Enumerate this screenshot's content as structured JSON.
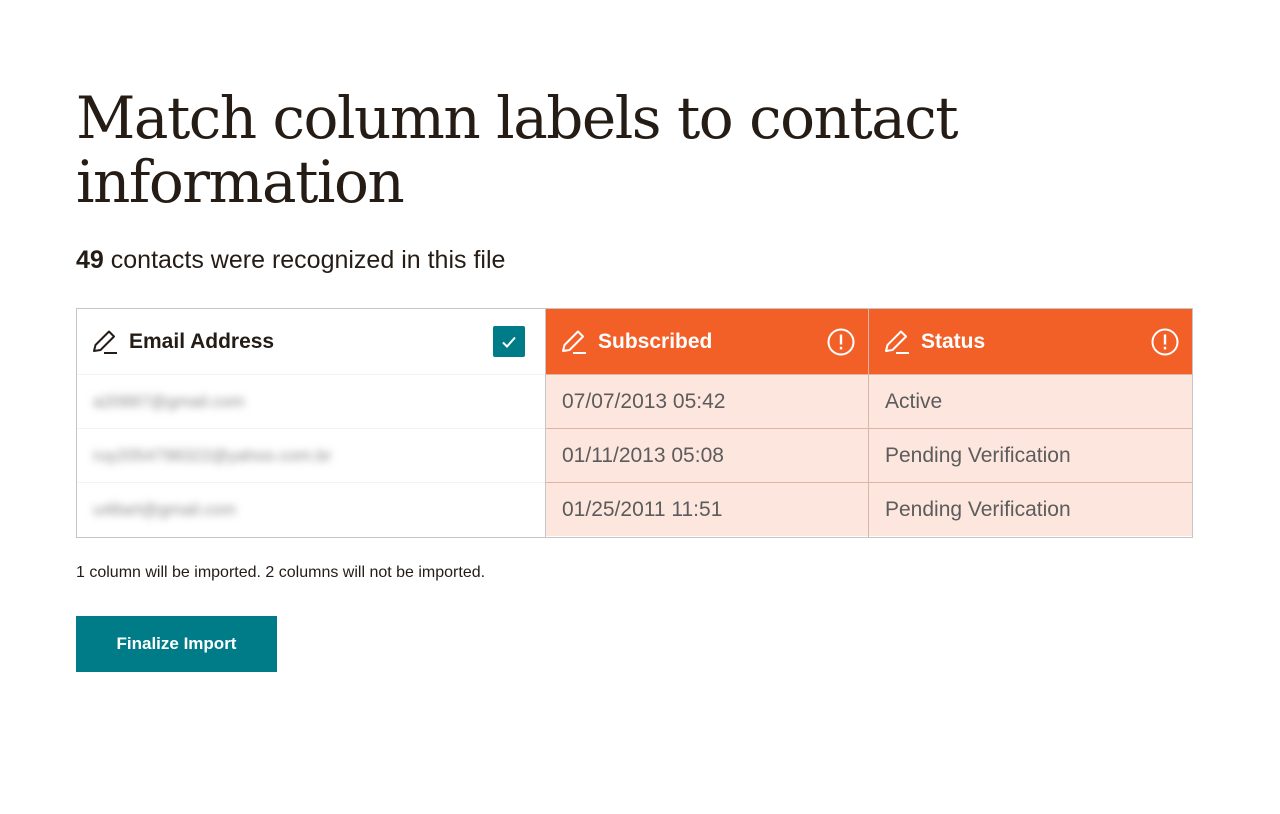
{
  "page": {
    "title": "Match column labels to contact information",
    "subtitle_count": "49",
    "subtitle_rest": " contacts were recognized in this file"
  },
  "columns": [
    {
      "header": "Email Address",
      "state": "checked",
      "rows": [
        "a20887@gmail.com",
        "ruy2054798322@yahoo.com.br",
        "u48art@gmail.com"
      ]
    },
    {
      "header": "Subscribed",
      "state": "warning",
      "rows": [
        "07/07/2013 05:42",
        "01/11/2013 05:08",
        "01/25/2011 11:51"
      ]
    },
    {
      "header": "Status",
      "state": "warning",
      "rows": [
        "Active",
        "Pending Verification",
        "Pending Verification"
      ]
    }
  ],
  "note": "1 column will be imported. 2 columns will not be imported.",
  "button": {
    "label": "Finalize Import"
  },
  "colors": {
    "accent_teal": "#007c89",
    "warning_orange": "#f26027",
    "warning_cell_bg": "#fde6de",
    "text_dark": "#241c15"
  },
  "icons": [
    "pencil-icon",
    "checkmark-icon",
    "warning-icon"
  ]
}
